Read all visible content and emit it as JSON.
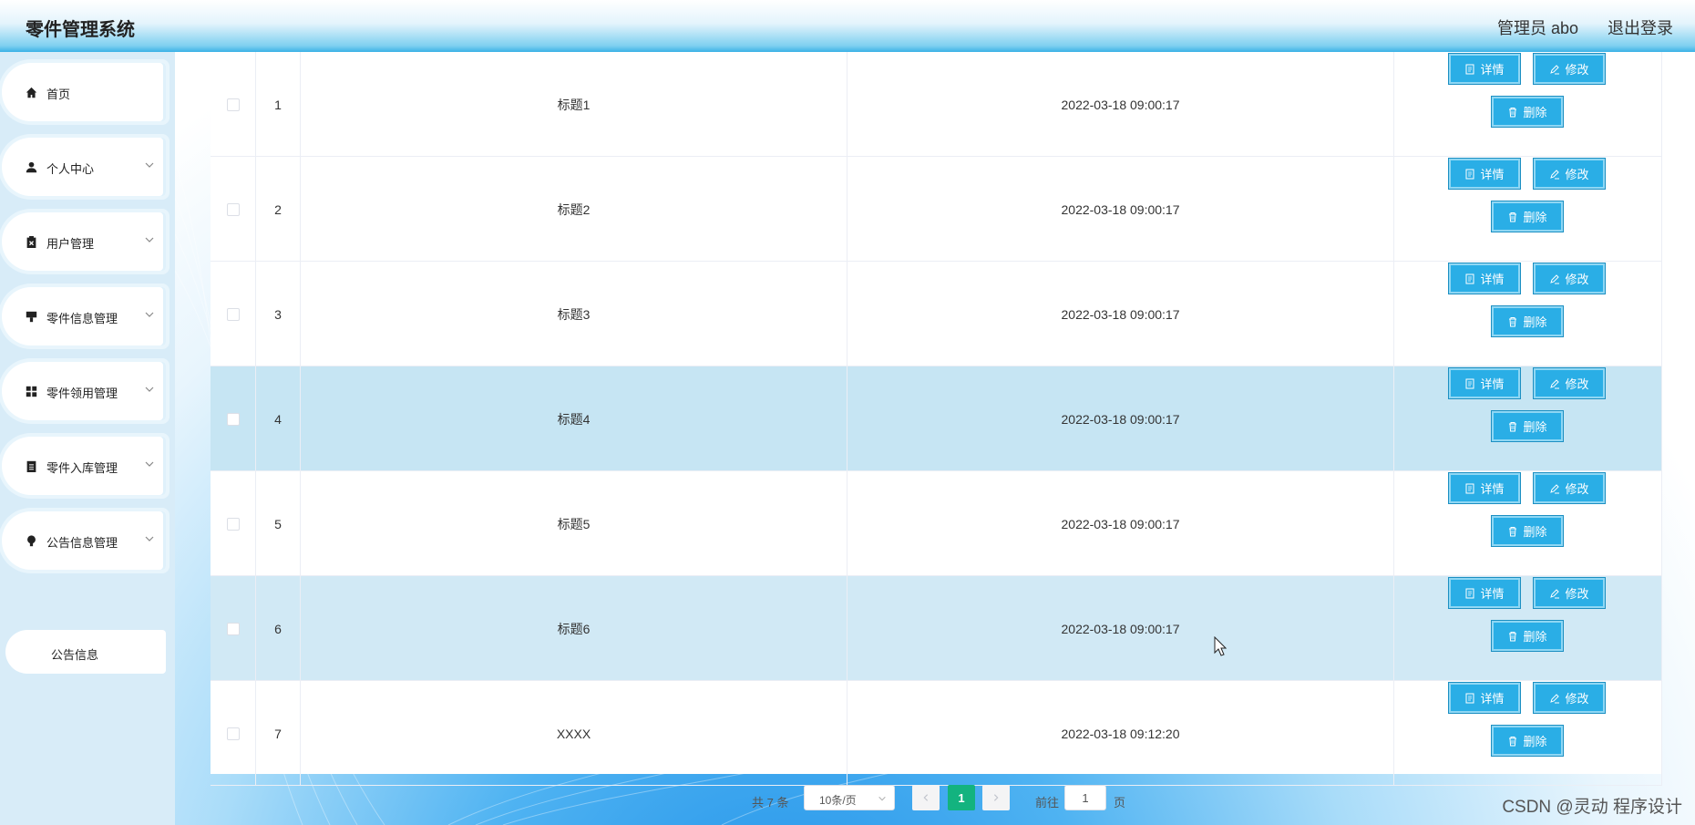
{
  "header": {
    "title": "零件管理系统",
    "user": "管理员 abo",
    "logout": "退出登录"
  },
  "sidebar": {
    "items": [
      {
        "label": "首页",
        "icon": "home-icon"
      },
      {
        "label": "个人中心",
        "icon": "user-icon"
      },
      {
        "label": "用户管理",
        "icon": "clipboard-x-icon"
      },
      {
        "label": "零件信息管理",
        "icon": "stamp-icon"
      },
      {
        "label": "零件领用管理",
        "icon": "grid-icon"
      },
      {
        "label": "零件入库管理",
        "icon": "list-icon"
      },
      {
        "label": "公告信息管理",
        "icon": "bulb-icon"
      }
    ],
    "sub_item": "公告信息"
  },
  "table": {
    "rows": [
      {
        "index": "1",
        "title": "标题1",
        "time": "2022-03-18 09:00:17"
      },
      {
        "index": "2",
        "title": "标题2",
        "time": "2022-03-18 09:00:17"
      },
      {
        "index": "3",
        "title": "标题3",
        "time": "2022-03-18 09:00:17"
      },
      {
        "index": "4",
        "title": "标题4",
        "time": "2022-03-18 09:00:17"
      },
      {
        "index": "5",
        "title": "标题5",
        "time": "2022-03-18 09:00:17"
      },
      {
        "index": "6",
        "title": "标题6",
        "time": "2022-03-18 09:00:17"
      },
      {
        "index": "7",
        "title": "XXXX",
        "time": "2022-03-18 09:12:20"
      }
    ],
    "actions": {
      "detail": "详情",
      "edit": "修改",
      "delete": "删除"
    }
  },
  "pager": {
    "total": "共 7 条",
    "page_size": "10条/页",
    "current": "1",
    "goto": "前往",
    "goto_value": "1",
    "page_suffix": "页"
  },
  "watermark": "CSDN @灵动 程序设计",
  "colors": {
    "accent": "#2aaee6",
    "pager_active": "#13b37f",
    "row_highlight": "#c6e5f3"
  }
}
